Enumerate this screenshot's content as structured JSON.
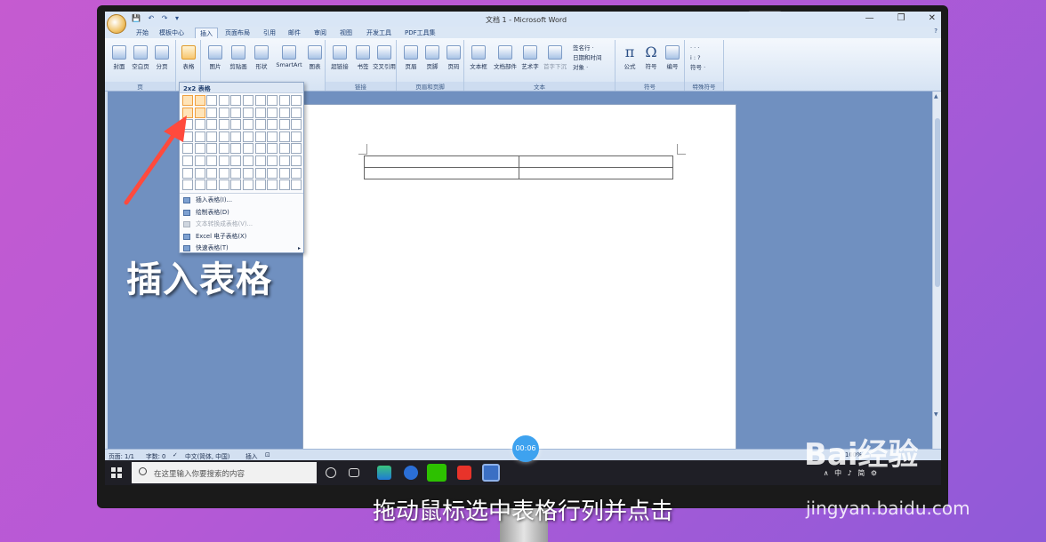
{
  "window": {
    "title": "文档 1 - Microsoft Word",
    "controls": [
      "—",
      "❐",
      "✕"
    ]
  },
  "tabs": [
    "开始",
    "模板中心",
    "插入",
    "页面布局",
    "引用",
    "邮件",
    "审阅",
    "视图",
    "开发工具",
    "PDF工具集"
  ],
  "active_tab": "插入",
  "ribbon": {
    "pages": {
      "label": "页",
      "buttons": [
        "封面",
        "空白页",
        "分页"
      ]
    },
    "table": {
      "button": "表格"
    },
    "illustrations": {
      "buttons": [
        "图片",
        "剪贴画",
        "形状",
        "SmartArt",
        "图表"
      ]
    },
    "links": {
      "label": "链接",
      "buttons": [
        "超链接",
        "书签",
        "交叉引用"
      ]
    },
    "header_footer": {
      "label": "页眉和页脚",
      "buttons": [
        "页眉",
        "页脚",
        "页码"
      ]
    },
    "text": {
      "label": "文本",
      "buttons": [
        "文本框",
        "文档部件",
        "艺术字",
        "首字下沉"
      ],
      "small": [
        "签名行 ·",
        "日期和时间",
        "对象 ·"
      ]
    },
    "symbols": {
      "label": "符号",
      "buttons": [
        "公式",
        "符号",
        "编号"
      ]
    },
    "special": {
      "label": "特殊符号",
      "small": [
        "符号 ·"
      ]
    }
  },
  "dropdown": {
    "header": "2x2 表格",
    "items": [
      {
        "label": "插入表格(I)...",
        "disabled": false
      },
      {
        "label": "绘制表格(D)",
        "disabled": false
      },
      {
        "label": "文本转换成表格(V)...",
        "disabled": true
      },
      {
        "label": "Excel 电子表格(X)",
        "disabled": false
      },
      {
        "label": "快速表格(T)",
        "disabled": false,
        "submenu": true
      }
    ],
    "grid_cols": 10,
    "grid_rows": 8,
    "selected_cols": 2,
    "selected_rows": 2
  },
  "statusbar": {
    "page": "页面: 1/1",
    "words": "字数: 0",
    "lang": "中文(简体, 中国)",
    "mode": "插入",
    "zoom": "100%"
  },
  "taskbar": {
    "search_placeholder": "在这里输入你要搜索的内容",
    "tray": "∧ 中 ♪ 简 ⚙"
  },
  "overlay": {
    "caption": "插入表格",
    "subtitle": "拖动鼠标选中表格行列并点击",
    "timer": "00:06",
    "watermark": "Bai经验",
    "watermark_url": "jingyan.baidu.com"
  }
}
